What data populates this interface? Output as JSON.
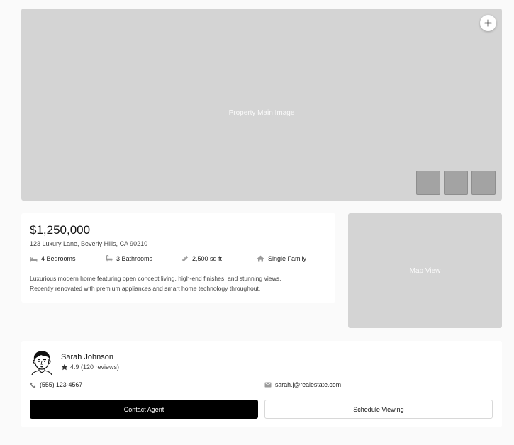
{
  "hero": {
    "image_label": "Property Main Image",
    "favorite_icon": "plus-icon",
    "thumbnail_count": 3
  },
  "listing": {
    "price": "$1,250,000",
    "address": "123 Luxury Lane, Beverly Hills, CA 90210",
    "features": [
      {
        "icon": "bed-icon",
        "label": "4 Bedrooms"
      },
      {
        "icon": "bath-icon",
        "label": "3 Bathrooms"
      },
      {
        "icon": "ruler-icon",
        "label": "2,500 sq ft"
      },
      {
        "icon": "home-icon",
        "label": "Single Family"
      }
    ],
    "description_line1": "Luxurious modern home featuring open concept living, high-end finishes, and stunning views.",
    "description_line2": "Recently renovated with premium appliances and smart home technology throughout."
  },
  "map": {
    "label": "Map View"
  },
  "agent": {
    "name": "Sarah Johnson",
    "rating": "4.9 (120 reviews)",
    "phone": "(555) 123-4567",
    "email": "sarah.j@realestate.com",
    "contact_label": "Contact Agent",
    "schedule_label": "Schedule Viewing"
  },
  "colors": {
    "placeholder": "#d4d4d4",
    "thumbnail": "#a3a3a3",
    "primary_button": "#000000",
    "page_background": "#fafafa"
  }
}
